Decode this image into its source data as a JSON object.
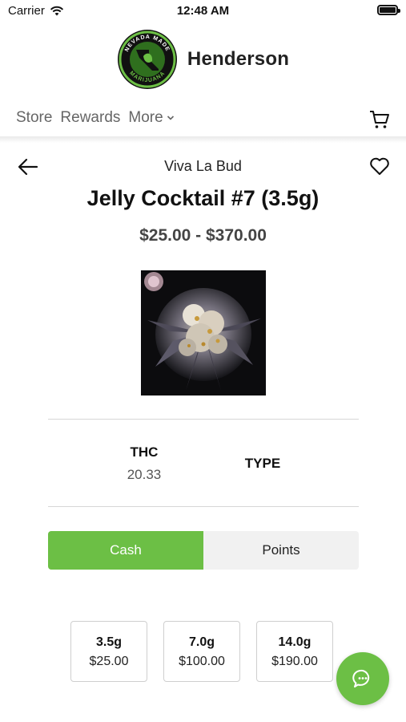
{
  "status_bar": {
    "carrier": "Carrier",
    "time": "12:48 AM"
  },
  "header": {
    "store_name": "Henderson",
    "logo_text": "NEVADA MADE MARIJUANA",
    "logo_top": "NEVADA MADE",
    "logo_bottom": "MARIJUANA"
  },
  "nav": {
    "items": [
      "Store",
      "Rewards",
      "More"
    ]
  },
  "product": {
    "brand": "Viva La Bud",
    "name": "Jelly Cocktail #7 (3.5g)",
    "price_range": "$25.00 - $370.00",
    "thc_label": "THC",
    "thc_value": "20.33",
    "type_label": "TYPE"
  },
  "payment_toggle": {
    "options": [
      "Cash",
      "Points"
    ],
    "selected": "Cash"
  },
  "sizes": [
    {
      "weight": "3.5g",
      "price": "$25.00"
    },
    {
      "weight": "7.0g",
      "price": "$100.00"
    },
    {
      "weight": "14.0g",
      "price": "$190.00"
    }
  ],
  "icons": {
    "wifi": "wifi-icon",
    "battery": "battery-icon",
    "cart": "cart-icon",
    "back": "back-arrow-icon",
    "favorite": "heart-icon",
    "more": "chevron-down-icon",
    "chat": "chat-icon"
  },
  "colors": {
    "accent": "#6cbf45",
    "logo_ring": "#2f6f1e"
  }
}
